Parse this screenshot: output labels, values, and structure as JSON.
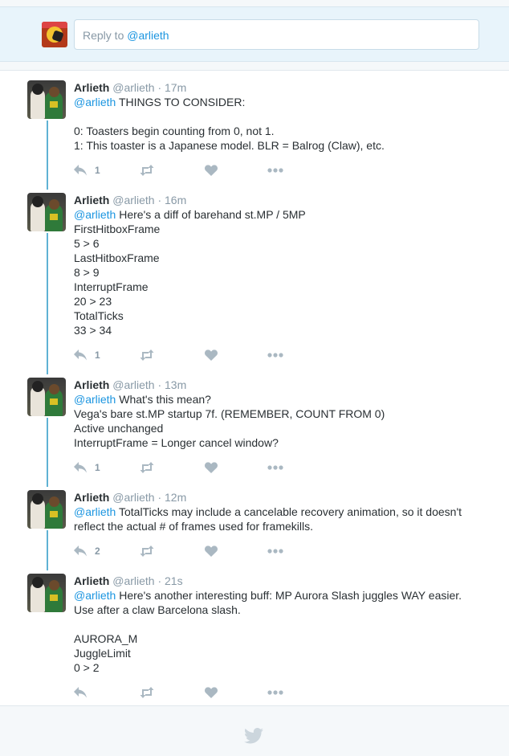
{
  "reply_box": {
    "prefix": "Reply to ",
    "handle": "@arlieth"
  },
  "tweets": [
    {
      "name": "Arlieth",
      "meta": "@arlieth · 17m",
      "lines": [
        {
          "mention": "@arlieth",
          "text": " THINGS TO CONSIDER:"
        },
        {
          "mention": "",
          "text": ""
        },
        {
          "mention": "",
          "text": "0: Toasters begin counting from 0, not 1."
        },
        {
          "mention": "",
          "text": "1: This toaster is a Japanese model. BLR = Balrog (Claw), etc."
        }
      ],
      "reply_count": "1"
    },
    {
      "name": "Arlieth",
      "meta": "@arlieth · 16m",
      "lines": [
        {
          "mention": "@arlieth",
          "text": " Here's a diff of barehand st.MP / 5MP"
        },
        {
          "mention": "",
          "text": "FirstHitboxFrame"
        },
        {
          "mention": "",
          "text": "5 > 6"
        },
        {
          "mention": "",
          "text": "LastHitboxFrame"
        },
        {
          "mention": "",
          "text": "8 > 9"
        },
        {
          "mention": "",
          "text": "InterruptFrame"
        },
        {
          "mention": "",
          "text": "20 > 23"
        },
        {
          "mention": "",
          "text": "TotalTicks"
        },
        {
          "mention": "",
          "text": "33 > 34"
        }
      ],
      "reply_count": "1"
    },
    {
      "name": "Arlieth",
      "meta": "@arlieth · 13m",
      "lines": [
        {
          "mention": "@arlieth",
          "text": " What's this mean?"
        },
        {
          "mention": "",
          "text": "Vega's bare st.MP startup 7f. (REMEMBER, COUNT FROM 0)"
        },
        {
          "mention": "",
          "text": "Active unchanged"
        },
        {
          "mention": "",
          "text": "InterruptFrame = Longer cancel window?"
        }
      ],
      "reply_count": "1"
    },
    {
      "name": "Arlieth",
      "meta": "@arlieth · 12m",
      "lines": [
        {
          "mention": "@arlieth",
          "text": " TotalTicks may include a cancelable recovery animation, so it doesn't"
        },
        {
          "mention": "",
          "text": "reflect the actual # of frames used for framekills."
        }
      ],
      "reply_count": "2"
    },
    {
      "name": "Arlieth",
      "meta": "@arlieth · 21s",
      "lines": [
        {
          "mention": "@arlieth",
          "text": " Here's another interesting buff: MP Aurora Slash juggles WAY easier."
        },
        {
          "mention": "",
          "text": "Use after a claw Barcelona slash."
        },
        {
          "mention": "",
          "text": ""
        },
        {
          "mention": "",
          "text": "AURORA_M"
        },
        {
          "mention": "",
          "text": "JuggleLimit"
        },
        {
          "mention": "",
          "text": "0 > 2"
        }
      ],
      "reply_count": ""
    }
  ],
  "icons": {
    "reply": "reply-icon",
    "retweet": "retweet-icon",
    "like": "heart-icon",
    "more": "more-dots-icon",
    "footer": "twitter-bird-icon"
  },
  "colors": {
    "accent": "#1b95e0",
    "thread_line": "#5fb2d4",
    "muted": "#8899a6",
    "icon": "#aab8c2"
  }
}
